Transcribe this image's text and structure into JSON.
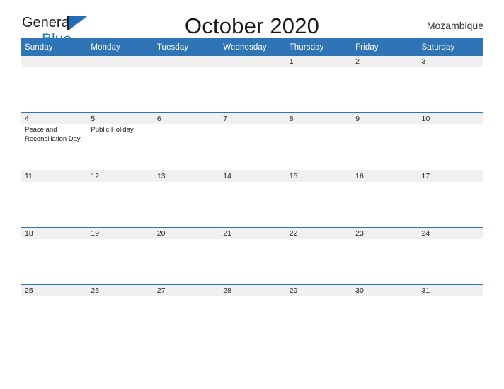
{
  "branding": {
    "logo_text_top": "General",
    "logo_text_bottom": "Blue",
    "logo_icon": "flag-triangle-icon",
    "logo_accent_color": "#1f7ac4"
  },
  "header": {
    "title": "October 2020",
    "region": "Mozambique"
  },
  "colors": {
    "header_blue": "#2f75b5",
    "daynum_strip": "#f0f0f0",
    "cell_background": "#ffffff",
    "text": "#262626"
  },
  "calendar": {
    "weekday_headers": [
      "Sunday",
      "Monday",
      "Tuesday",
      "Wednesday",
      "Thursday",
      "Friday",
      "Saturday"
    ],
    "weeks": [
      [
        {
          "day": "",
          "event": ""
        },
        {
          "day": "",
          "event": ""
        },
        {
          "day": "",
          "event": ""
        },
        {
          "day": "",
          "event": ""
        },
        {
          "day": "1",
          "event": ""
        },
        {
          "day": "2",
          "event": ""
        },
        {
          "day": "3",
          "event": ""
        }
      ],
      [
        {
          "day": "4",
          "event": "Peace and Reconciliation Day"
        },
        {
          "day": "5",
          "event": "Public Holiday"
        },
        {
          "day": "6",
          "event": ""
        },
        {
          "day": "7",
          "event": ""
        },
        {
          "day": "8",
          "event": ""
        },
        {
          "day": "9",
          "event": ""
        },
        {
          "day": "10",
          "event": ""
        }
      ],
      [
        {
          "day": "11",
          "event": ""
        },
        {
          "day": "12",
          "event": ""
        },
        {
          "day": "13",
          "event": ""
        },
        {
          "day": "14",
          "event": ""
        },
        {
          "day": "15",
          "event": ""
        },
        {
          "day": "16",
          "event": ""
        },
        {
          "day": "17",
          "event": ""
        }
      ],
      [
        {
          "day": "18",
          "event": ""
        },
        {
          "day": "19",
          "event": ""
        },
        {
          "day": "20",
          "event": ""
        },
        {
          "day": "21",
          "event": ""
        },
        {
          "day": "22",
          "event": ""
        },
        {
          "day": "23",
          "event": ""
        },
        {
          "day": "24",
          "event": ""
        }
      ],
      [
        {
          "day": "25",
          "event": ""
        },
        {
          "day": "26",
          "event": ""
        },
        {
          "day": "27",
          "event": ""
        },
        {
          "day": "28",
          "event": ""
        },
        {
          "day": "29",
          "event": ""
        },
        {
          "day": "30",
          "event": ""
        },
        {
          "day": "31",
          "event": ""
        }
      ]
    ]
  }
}
